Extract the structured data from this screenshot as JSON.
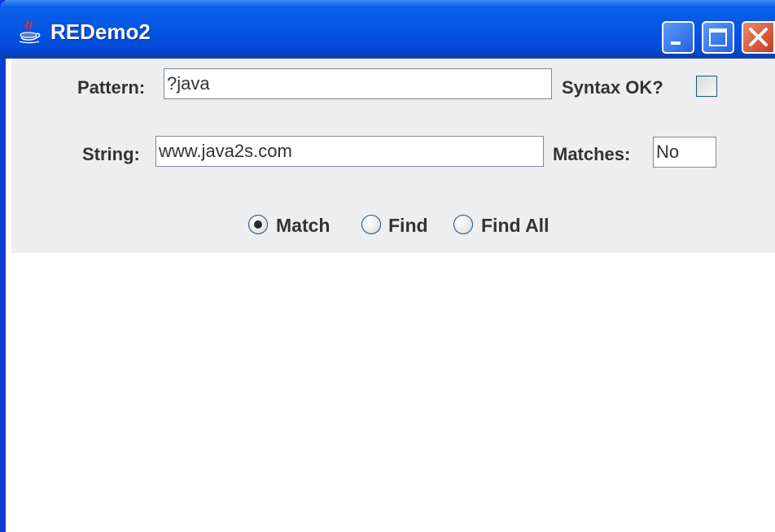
{
  "window": {
    "title": "REDemo2",
    "icon": "java-coffee-cup-icon",
    "titlebar_color": "#0555E4",
    "controls": {
      "minimize": "minimize-icon",
      "maximize": "maximize-icon",
      "close": "close-icon"
    }
  },
  "form": {
    "pattern_label": "Pattern:",
    "pattern_value": "?java",
    "syntax_label": "Syntax OK?",
    "syntax_checked": false,
    "string_label": "String:",
    "string_value": "www.java2s.com",
    "matches_label": "Matches:",
    "matches_value": "No"
  },
  "modes": {
    "selected": "Match",
    "options": [
      {
        "label": "Match",
        "selected": true
      },
      {
        "label": "Find",
        "selected": false
      },
      {
        "label": "Find All",
        "selected": false
      }
    ]
  }
}
